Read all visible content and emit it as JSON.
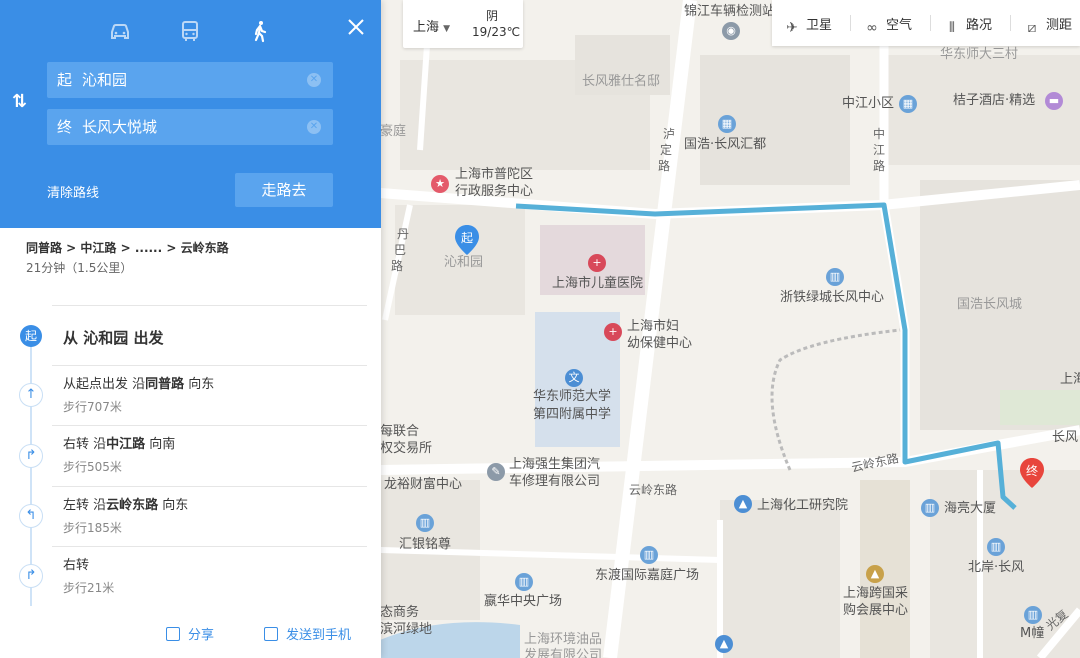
{
  "transport_modes": [
    "car-icon",
    "bus-icon",
    "walk-icon"
  ],
  "route": {
    "start_tag": "起",
    "start": "沁和园",
    "end_tag": "终",
    "end": "长风大悦城",
    "clear_label": "清除路线",
    "go_label": "走路去"
  },
  "summary": {
    "path": "同普路 > 中江路 > ...... > 云岭东路",
    "time": "21分钟（1.5公里）"
  },
  "steps": {
    "start_marker": "起",
    "depart": "从 沁和园 出发",
    "items": [
      {
        "pre": "从起点出发 沿",
        "road": "同普路",
        "post": " 向东",
        "dist": "步行707米",
        "icon": "straight-arrow-icon"
      },
      {
        "pre": "右转 沿",
        "road": "中江路",
        "post": " 向南",
        "dist": "步行505米",
        "icon": "turn-right-icon"
      },
      {
        "pre": "左转 沿",
        "road": "云岭东路",
        "post": " 向东",
        "dist": "步行185米",
        "icon": "turn-left-icon"
      },
      {
        "pre": "右转",
        "road": "",
        "post": "",
        "dist": "步行21米",
        "icon": "turn-right-icon"
      }
    ]
  },
  "footer": {
    "share": "分享",
    "send": "发送到手机"
  },
  "weather": {
    "city": "上海",
    "condition": "阴",
    "temp": "19/23℃"
  },
  "toolbar": {
    "satellite": "卫星",
    "air": "空气",
    "traffic": "路况",
    "measure": "测距"
  },
  "map_labels": {
    "jinjiang": "锦江车辆检测站",
    "changfeng_yashi": "长风雅仕名邸",
    "huadong_sancun": "华东师大三村",
    "zhongjiang_xiaoqu": "中江小区",
    "juzi_hotel": "桔子酒店·精选",
    "huting": "豪庭",
    "hao": "浩",
    "putuo_admin_1": "上海市普陀区",
    "putuo_admin_2": "行政服务中心",
    "guohao_huidu": "国浩·长风汇都",
    "luding_lu_1": "泸",
    "luding_lu_2": "定",
    "luding_lu_3": "路",
    "zhongjiang_lu_1": "中",
    "zhongjiang_lu_2": "江",
    "zhongjiang_lu_3": "路",
    "danba_lu_1": "丹",
    "danba_lu_2": "巴",
    "danba_lu_3": "路",
    "qinheyuan": "沁和园",
    "children_hospital": "上海市儿童医院",
    "zheitie_center": "浙铁绿城长风中心",
    "guohao_changfeng": "国浩长风城",
    "maternal_1": "上海市妇",
    "maternal_2": "幼保健中心",
    "ecnu_1": "华东师范大学",
    "ecnu_2": "第四附属中学",
    "shanghai_top": "上海",
    "changfeng_right": "长风",
    "lianhe_1": "每联合",
    "lianhe_2": "权交易所",
    "qiangsheng_1": "上海强生集团汽",
    "qiangsheng_2": "车修理有限公司",
    "yunling_east_1": "云岭东路",
    "longyu": "龙裕财富中心",
    "yunling_east_2": "云岭东路",
    "chemical_institute": "上海化工研究院",
    "haiyang": "海亮大厦",
    "huiyin": "汇银铭尊",
    "dongdu": "东渡国际嘉庭广场",
    "beian": "北岸·长风",
    "kuajing_1": "上海跨国采",
    "kuajing_2": "购会展中心",
    "dtai": "态商务",
    "binhe": "滨河绿地",
    "huasheng": "嬴华中央广场",
    "huanjing_1": "上海环境油品",
    "huanjing_2": "发展有限公司",
    "guangfu": "光复",
    "mchuang": "M幢",
    "end_pin": "终",
    "start_pin": "起"
  }
}
